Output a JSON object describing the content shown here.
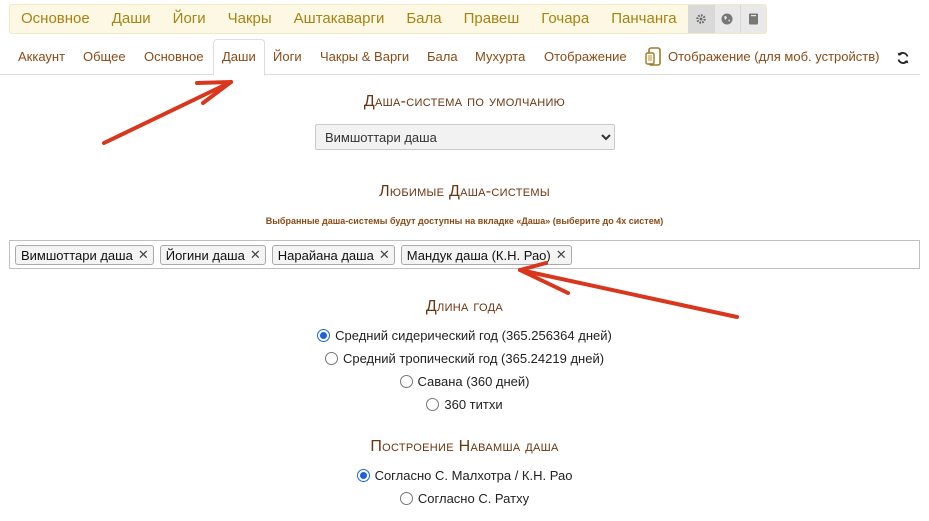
{
  "top_nav": {
    "items": [
      "Основное",
      "Даши",
      "Йоги",
      "Чакры",
      "Аштакаварги",
      "Бала",
      "Правеш",
      "Гочара",
      "Панчанга"
    ],
    "icons": [
      "gear-icon",
      "globe-icon",
      "book-icon"
    ]
  },
  "sub_nav": {
    "items": [
      "Аккаунт",
      "Общее",
      "Основное",
      "Даши",
      "Йоги",
      "Чакры & Варги",
      "Бала",
      "Мухурта",
      "Отображение"
    ],
    "mobile_label": "Отображение (для моб. устройств)",
    "active": "Даши"
  },
  "default_dasha": {
    "title": "Даша-система по умолчанию",
    "selected": "Вимшоттари даша"
  },
  "favorite_dashas": {
    "title": "Любимые Даша-системы",
    "hint": "Выбранные даша-системы будут доступны на вкладке «Даша» (выберите до 4х систем)",
    "tags": [
      "Вимшоттари даша",
      "Йогини даша",
      "Нарайана даша",
      "Мандук даша (К.Н. Рао)"
    ],
    "remove_symbol": "✕"
  },
  "year_length": {
    "title": "Длина года",
    "options": [
      "Средний сидерический год (365.256364 дней)",
      "Средний тропический год (365.24219 дней)",
      "Савана (360 дней)",
      "360 титхи"
    ],
    "selected_index": 0
  },
  "navamsha": {
    "title": "Построение Навамша даша",
    "options": [
      "Согласно С. Малхотра / К.Н. Рао",
      "Согласно С. Ратху"
    ],
    "selected_index": 0
  },
  "colors": {
    "top_nav_text": "#a78314",
    "sub_nav_text": "#8a4b16",
    "heading": "#6b3510",
    "annotation_arrow": "#d9361e",
    "radio_accent": "#1e63d8"
  }
}
